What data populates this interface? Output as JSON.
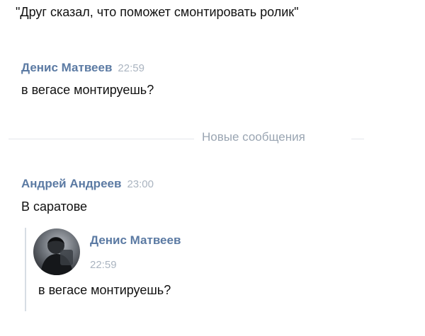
{
  "caption": "\"Друг сказал, что поможет смонтировать ролик\"",
  "messages": [
    {
      "author": "Денис Матвеев",
      "time": "22:59",
      "text": "в вегасе монтируешь?"
    },
    {
      "author": "Андрей Андреев",
      "time": "23:00",
      "text": "В саратове"
    }
  ],
  "divider": {
    "label": "Новые сообщения"
  },
  "forwarded": {
    "author": "Денис Матвеев",
    "time": "22:59",
    "text": "в вегасе монтируешь?",
    "avatar_icon": "user-avatar-photo"
  },
  "colors": {
    "author_name": "#5b7aa3",
    "timestamp": "#aab4c0",
    "divider_text": "#9aa5b2",
    "quote_bar": "#d7dde4"
  }
}
